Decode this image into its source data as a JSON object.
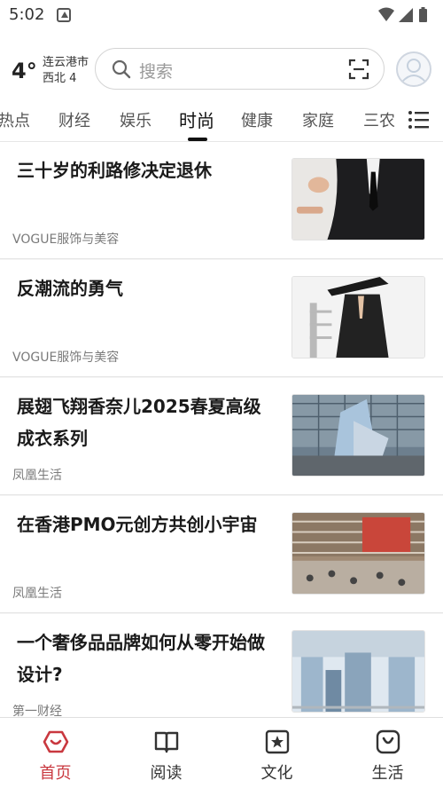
{
  "status_bar": {
    "time": "5:02"
  },
  "weather": {
    "temperature": "4°",
    "city": "连云港市",
    "wind": "西北 4"
  },
  "search": {
    "placeholder": "搜索"
  },
  "tabs": [
    {
      "label": "热点"
    },
    {
      "label": "财经"
    },
    {
      "label": "娱乐"
    },
    {
      "label": "时尚",
      "active": true
    },
    {
      "label": "健康"
    },
    {
      "label": "家庭"
    },
    {
      "label": "三农"
    }
  ],
  "articles": [
    {
      "title": "三十岁的利路修决定退休",
      "source": "VOGUE服饰与美容"
    },
    {
      "title": "反潮流的勇气",
      "source": "VOGUE服饰与美容"
    },
    {
      "title": "展翅飞翔香奈儿2025春夏高级成衣系列",
      "source": "凤凰生活"
    },
    {
      "title": "在香港PMO元创方共创小宇宙",
      "source": "凤凰生活"
    },
    {
      "title": "一个奢侈品品牌如何从零开始做设计?",
      "source": "第一财经"
    }
  ],
  "bottom_nav": [
    {
      "label": "首页",
      "icon": "home-icon",
      "active": true
    },
    {
      "label": "阅读",
      "icon": "book-icon"
    },
    {
      "label": "文化",
      "icon": "culture-icon"
    },
    {
      "label": "生活",
      "icon": "bag-icon"
    }
  ],
  "colors": {
    "accent": "#c9383f",
    "active_text": "#111111",
    "inactive_text": "#555555"
  }
}
